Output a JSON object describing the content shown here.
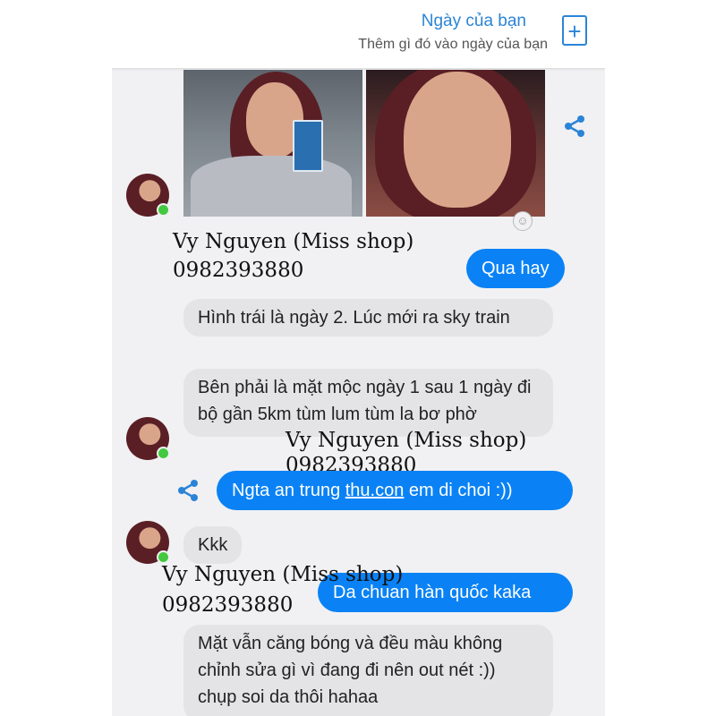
{
  "header": {
    "title": "Ngày của bạn",
    "subtitle": "Thêm gì đó vào ngày của bạn",
    "add_icon": "+"
  },
  "messages": {
    "in_1": "Hình trái là ngày 2. Lúc mới ra sky train",
    "in_2": "Bên phải là mặt mộc ngày 1 sau 1 ngày đi bộ gần 5km tùm lum tùm la bơ phờ",
    "out_1": "Qua hay",
    "out_2_pre": "Ngta an trung ",
    "out_2_link": "thu.con",
    "out_2_post": " em di choi :))",
    "in_3": "Kkk",
    "out_3": "Da chuan hàn quốc kaka",
    "in_4": "Mặt vẫn căng bóng và đều màu không chỉnh sửa gì vì đang đi nên out nét :)) chụp soi da thôi hahaa"
  },
  "watermark": {
    "name": "Vy Nguyen (Miss shop)",
    "phone": "0982393880"
  },
  "icons": [
    "plus-icon",
    "share-icon",
    "add-reaction-icon"
  ],
  "colors": {
    "outgoing": "#0a82f5",
    "incoming": "#e4e4e7",
    "online": "#43c940",
    "accent": "#2b84d6"
  }
}
